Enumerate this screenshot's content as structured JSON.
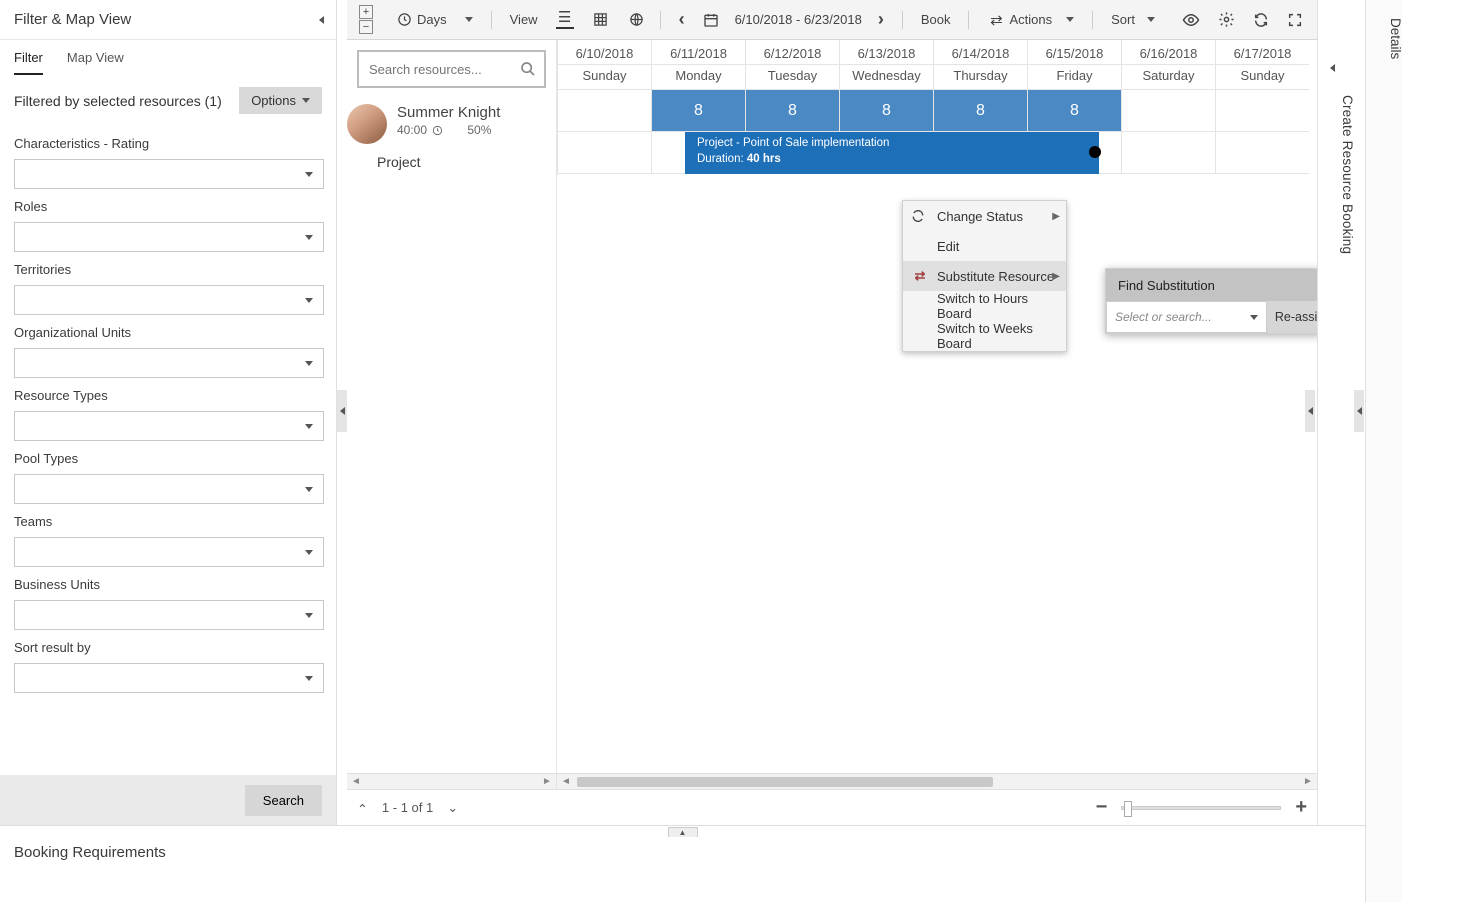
{
  "leftPanel": {
    "title": "Filter & Map View",
    "tabs": {
      "filter": "Filter",
      "mapView": "Map View"
    },
    "filteredLabel": "Filtered by selected resources (1)",
    "optionsLabel": "Options",
    "filters": [
      "Characteristics - Rating",
      "Roles",
      "Territories",
      "Organizational Units",
      "Resource Types",
      "Pool Types",
      "Teams",
      "Business Units",
      "Sort result by"
    ],
    "searchButton": "Search"
  },
  "toolbar": {
    "daysLabel": "Days",
    "viewLabel": "View",
    "dateRange": "6/10/2018 - 6/23/2018",
    "bookLabel": "Book",
    "actionsLabel": "Actions",
    "sortLabel": "Sort"
  },
  "search": {
    "placeholder": "Search resources..."
  },
  "resource": {
    "name": "Summer Knight",
    "hours": "40:00",
    "utilization": "50%",
    "expandedLabel": "Project"
  },
  "calendar": {
    "columns": [
      {
        "date": "6/10/2018",
        "dow": "Sunday"
      },
      {
        "date": "6/11/2018",
        "dow": "Monday"
      },
      {
        "date": "6/12/2018",
        "dow": "Tuesday"
      },
      {
        "date": "6/13/2018",
        "dow": "Wednesday"
      },
      {
        "date": "6/14/2018",
        "dow": "Thursday"
      },
      {
        "date": "6/15/2018",
        "dow": "Friday"
      },
      {
        "date": "6/16/2018",
        "dow": "Saturday"
      },
      {
        "date": "6/17/2018",
        "dow": "Sunday"
      }
    ],
    "availability": [
      "",
      "8",
      "8",
      "8",
      "8",
      "8",
      "",
      ""
    ]
  },
  "booking": {
    "titlePrefix": "Project - ",
    "title": "Point of Sale implementation",
    "durationLabel": "Duration: ",
    "duration": "40 hrs"
  },
  "contextMenu": {
    "changeStatus": "Change Status",
    "edit": "Edit",
    "substitute": "Substitute Resource",
    "hoursBoard": "Switch to Hours Board",
    "weeksBoard": "Switch to Weeks Board"
  },
  "subPopup": {
    "header": "Find Substitution",
    "placeholder": "Select or search...",
    "button": "Re-assign"
  },
  "pager": {
    "text": "1 - 1 of 1"
  },
  "rightTabs": {
    "create": "Create Resource Booking",
    "details": "Details"
  },
  "bottomPanel": {
    "title": "Booking Requirements"
  }
}
